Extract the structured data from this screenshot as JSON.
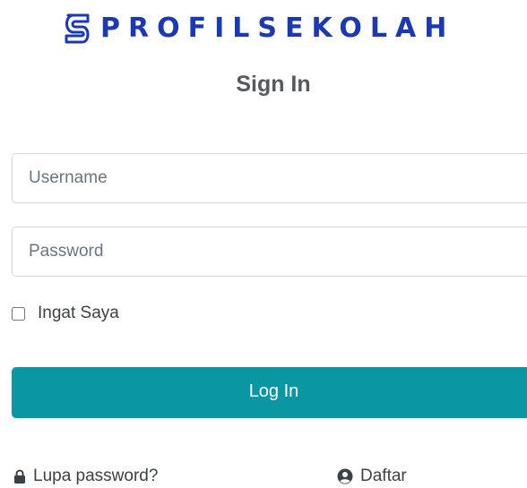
{
  "brand": {
    "name": "PROFILSEKOLAH",
    "color": "#1b39b5"
  },
  "form": {
    "title": "Sign In",
    "username_placeholder": "Username",
    "password_placeholder": "Password",
    "remember_label": "Ingat Saya",
    "login_label": "Log In",
    "login_color": "#0a97a3"
  },
  "links": {
    "forgot": {
      "label": "Lupa password?",
      "icon": "lock-icon"
    },
    "register": {
      "label": "Daftar",
      "icon": "user-circle-icon"
    }
  }
}
